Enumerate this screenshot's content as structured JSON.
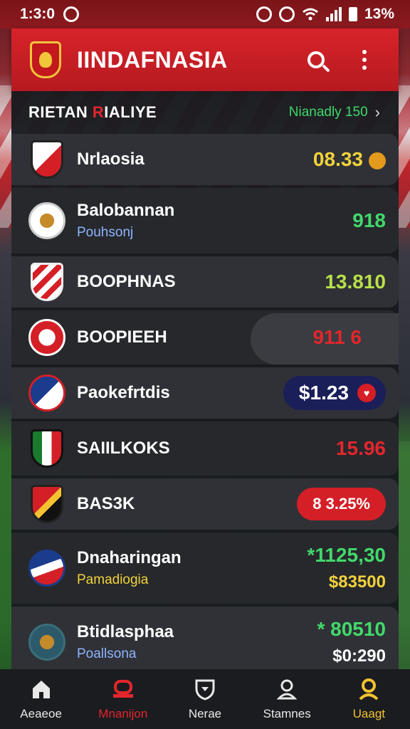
{
  "status": {
    "time": "1:3:0",
    "battery": "13%"
  },
  "appbar": {
    "title": "IINDAFNASIA"
  },
  "panel": {
    "title_main": "RIETAN ",
    "title_accent": "R",
    "title_rest": "IALIYE",
    "link": "Nianadly 150",
    "chevron": "›"
  },
  "rows": [
    {
      "name": "Nrlaosia",
      "sub": "",
      "value": "08.33",
      "value_color": "yellow",
      "value_style": "coin"
    },
    {
      "name": "Balobannan",
      "sub": "Pouhsonj",
      "value": "918",
      "value_color": "green",
      "value_style": "plain"
    },
    {
      "name": "BOOPHNAS",
      "sub": "",
      "value": "13.810",
      "value_color": "lime",
      "value_style": "plain"
    },
    {
      "name": "BOOPIEEH",
      "sub": "",
      "value": "911 6",
      "value_color": "red",
      "value_style": "ghost"
    },
    {
      "name": "Paokefrtdis",
      "sub": "",
      "value": "$1.23",
      "value_color": "white",
      "value_style": "navy"
    },
    {
      "name": "SAIILKOKS",
      "sub": "",
      "value": "15.96",
      "value_color": "red",
      "value_style": "plain"
    },
    {
      "name": "BAS3K",
      "sub": "",
      "value": "8 3.25%",
      "value_color": "white",
      "value_style": "redpill"
    },
    {
      "name": "Dnaharingan",
      "sub": "Pamadiogia",
      "sub_color": "gold",
      "value": "*1125,30",
      "value_sub": "$83500",
      "value_color": "green",
      "value_sub_color": "gold",
      "value_style": "double"
    },
    {
      "name": "Btidlasphaa",
      "sub": "Poallsona",
      "value": "* 80510",
      "value_sub": "$0:290",
      "value_color": "green",
      "value_sub_color": "white",
      "value_style": "double"
    }
  ],
  "nav": [
    {
      "label": "Aeaeoe",
      "icon": "home-icon"
    },
    {
      "label": "Mnanijon",
      "icon": "stadium-icon",
      "active": true
    },
    {
      "label": "Nerae",
      "icon": "shield-icon"
    },
    {
      "label": "Stamnes",
      "icon": "person-icon"
    },
    {
      "label": "Uaagt",
      "icon": "user-icon",
      "gold": true
    }
  ],
  "colors": {
    "brand_red": "#d8232a",
    "green": "#42d96b",
    "yellow": "#f2d23b",
    "navy": "#1a1f5a"
  }
}
